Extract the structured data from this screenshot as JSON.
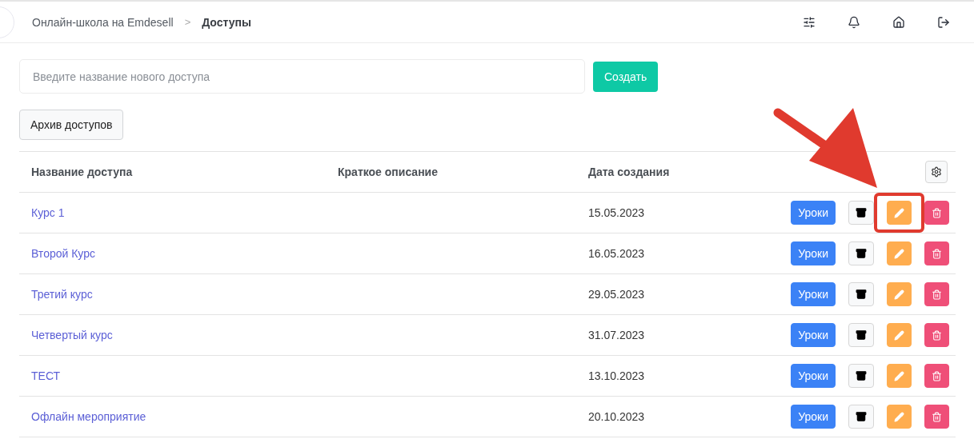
{
  "breadcrumb": {
    "parent": "Онлайн-школа на Emdesell",
    "separator": ">",
    "current": "Доступы"
  },
  "create": {
    "placeholder": "Введите название нового доступа",
    "button": "Создать"
  },
  "archive_button": "Архив доступов",
  "table": {
    "columns": [
      "Название доступа",
      "Краткое описание",
      "Дата создания"
    ],
    "rows": [
      {
        "name": "Курс 1",
        "date": "15.05.2023",
        "lessons": "Уроки",
        "highlighted": true
      },
      {
        "name": "Второй Курс",
        "date": "16.05.2023",
        "lessons": "Уроки",
        "highlighted": false
      },
      {
        "name": "Третий курс",
        "date": "29.05.2023",
        "lessons": "Уроки",
        "highlighted": false
      },
      {
        "name": "Четвертый курс",
        "date": "31.07.2023",
        "lessons": "Уроки",
        "highlighted": false
      },
      {
        "name": "ТЕСТ",
        "date": "13.10.2023",
        "lessons": "Уроки",
        "highlighted": false
      },
      {
        "name": "Офлайн мероприятие",
        "date": "20.10.2023",
        "lessons": "Уроки",
        "highlighted": false
      }
    ]
  }
}
